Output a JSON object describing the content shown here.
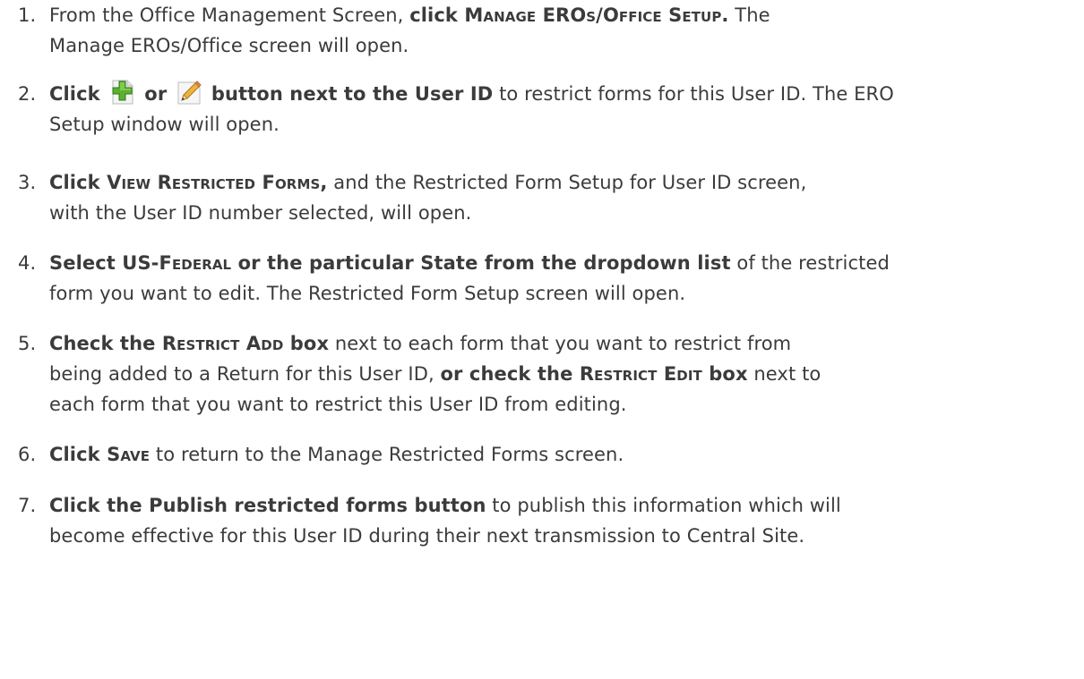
{
  "steps": [
    {
      "num": "1.",
      "p1": "From the Office Management Screen, ",
      "b1": "click ",
      "sc1": "Manage EROs/Office Setup.",
      "p2": " The",
      "p3": "Manage EROs/Office screen will open."
    },
    {
      "num": "2.",
      "b1": "Click",
      "b2": "or",
      "b3": "button next to the User ID",
      "p1": " to restrict forms for this User ID. The ERO",
      "p2": "Setup window will open.",
      "add_icon": "add-green-plus-icon",
      "edit_icon": "edit-pencil-icon"
    },
    {
      "num": "3.",
      "b1": "Click ",
      "sc1": "View Restricted Forms,",
      "p1": " and the Restricted Form Setup for User ID screen,",
      "p2": "with the User ID number selected, will open."
    },
    {
      "num": "4.",
      "b1": "Select US-",
      "sc1": "Federal",
      "b2": " or the particular State from the dropdown list",
      "p1": " of the restricted",
      "p2": "form you want to edit. The Restricted Form Setup screen will open."
    },
    {
      "num": "5.",
      "b1": "Check the ",
      "sc1": "Restrict Add",
      "b2": " box",
      "p1": " next to each form that you want to restrict from",
      "p2": "being added to a Return for this User ID, ",
      "b3": "or check the ",
      "sc2": "Restrict Edit",
      "b4": " box",
      "p3": " next to",
      "p4": "each form that you want to restrict this User ID from editing."
    },
    {
      "num": "6.",
      "b1": "Click ",
      "sc1": "Save",
      "p1": " to return to the Manage Restricted Forms screen."
    },
    {
      "num": "7.",
      "b1": "Click the Publish restricted forms button",
      "p1": " to publish this information which will",
      "p2": "become effective for this User ID during their next transmission to Central Site."
    }
  ]
}
